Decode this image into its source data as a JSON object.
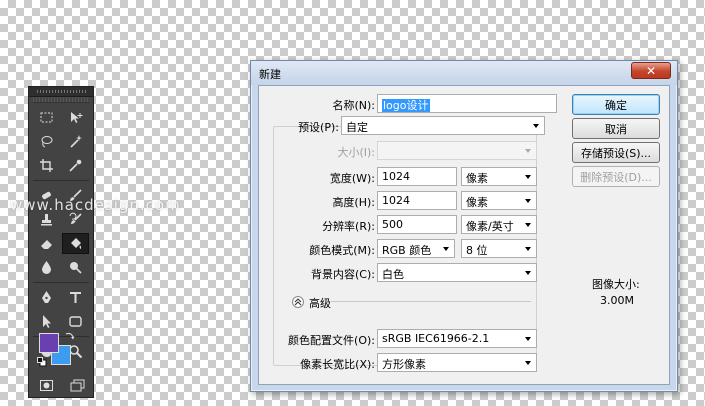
{
  "watermark": "www.hacdesign.com",
  "dialog": {
    "title": "新建",
    "close_glyph": "✕",
    "name_label": "名称(N):",
    "name_value": "logo设计",
    "preset_label": "预设(P):",
    "preset_value": "自定",
    "size_label": "大小(I):",
    "size_value": "",
    "width_label": "宽度(W):",
    "width_value": "1024",
    "width_unit": "像素",
    "height_label": "高度(H):",
    "height_value": "1024",
    "height_unit": "像素",
    "resolution_label": "分辨率(R):",
    "resolution_value": "500",
    "resolution_unit": "像素/英寸",
    "color_mode_label": "颜色模式(M):",
    "color_mode_value": "RGB 颜色",
    "bit_depth_value": "8 位",
    "bg_label": "背景内容(C):",
    "bg_value": "白色",
    "advanced_label": "高级",
    "color_profile_label": "颜色配置文件(O):",
    "color_profile_value": "sRGB IEC61966-2.1",
    "pixel_aspect_label": "像素长宽比(X):",
    "pixel_aspect_value": "方形像素",
    "buttons": {
      "ok": "确定",
      "cancel": "取消",
      "save_preset": "存储预设(S)...",
      "delete_preset": "删除预设(D)..."
    },
    "image_size_label": "图像大小:",
    "image_size_value": "3.00M"
  },
  "colors": {
    "foreground": "#6a3fb0",
    "background": "#3d9cf0"
  }
}
